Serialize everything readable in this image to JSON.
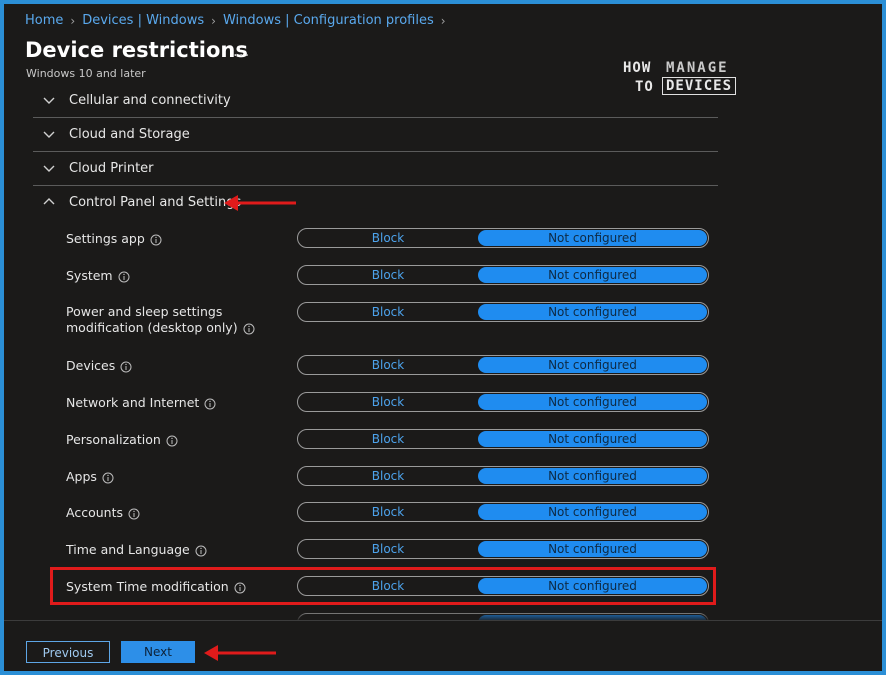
{
  "breadcrumb": [
    "Home",
    "Devices | Windows",
    "Windows | Configuration profiles"
  ],
  "page": {
    "title": "Device restrictions",
    "more_label": "...",
    "subtitle": "Windows 10 and later"
  },
  "logo": {
    "how": "HOW",
    "to": "TO",
    "manage": "MANAGE",
    "devices": "DEVICES"
  },
  "sections": [
    {
      "label": "Cellular and connectivity",
      "expanded": false
    },
    {
      "label": "Cloud and Storage",
      "expanded": false
    },
    {
      "label": "Cloud Printer",
      "expanded": false
    },
    {
      "label": "Control Panel and Settings",
      "expanded": true
    }
  ],
  "settings": [
    {
      "label": "Settings app",
      "options": [
        "Block",
        "Not configured"
      ],
      "selected": "Not configured"
    },
    {
      "label": "System",
      "options": [
        "Block",
        "Not configured"
      ],
      "selected": "Not configured"
    },
    {
      "label": "Power and sleep settings modification (desktop only)",
      "options": [
        "Block",
        "Not configured"
      ],
      "selected": "Not configured"
    },
    {
      "label": "Devices",
      "options": [
        "Block",
        "Not configured"
      ],
      "selected": "Not configured"
    },
    {
      "label": "Network and Internet",
      "options": [
        "Block",
        "Not configured"
      ],
      "selected": "Not configured"
    },
    {
      "label": "Personalization",
      "options": [
        "Block",
        "Not configured"
      ],
      "selected": "Not configured"
    },
    {
      "label": "Apps",
      "options": [
        "Block",
        "Not configured"
      ],
      "selected": "Not configured"
    },
    {
      "label": "Accounts",
      "options": [
        "Block",
        "Not configured"
      ],
      "selected": "Not configured"
    },
    {
      "label": "Time and Language",
      "options": [
        "Block",
        "Not configured"
      ],
      "selected": "Not configured"
    },
    {
      "label": "System Time modification",
      "options": [
        "Block",
        "Not configured"
      ],
      "selected": "Not configured",
      "highlighted": true
    }
  ],
  "footer": {
    "previous_label": "Previous",
    "next_label": "Next"
  },
  "colors": {
    "accent": "#1f8cf0",
    "annotation": "#e01b1b",
    "background": "#1b1a19",
    "frame": "#2b8fd6"
  }
}
